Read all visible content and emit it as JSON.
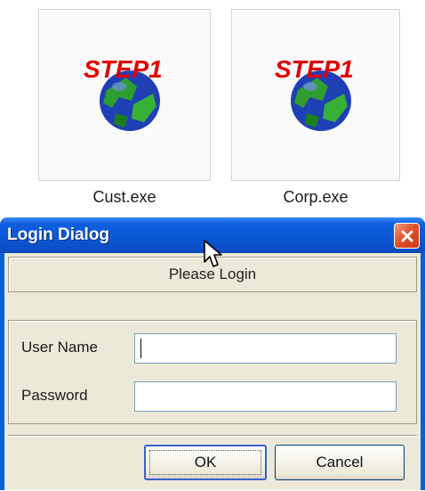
{
  "desktop": {
    "files": [
      {
        "name": "Cust.exe",
        "icon": "step1-globe-icon",
        "icon_text": "STEP1"
      },
      {
        "name": "Corp.exe",
        "icon": "step1-globe-icon",
        "icon_text": "STEP1"
      }
    ]
  },
  "dialog": {
    "title": "Login Dialog",
    "close_icon": "close-icon",
    "header": "Please Login",
    "fields": {
      "username": {
        "label": "User Name",
        "value": ""
      },
      "password": {
        "label": "Password",
        "value": ""
      }
    },
    "buttons": {
      "ok": "OK",
      "cancel": "Cancel"
    }
  },
  "colors": {
    "titlebar": "#0a58d6",
    "close_button": "#e0532d",
    "dialog_bg": "#ece9d8"
  }
}
